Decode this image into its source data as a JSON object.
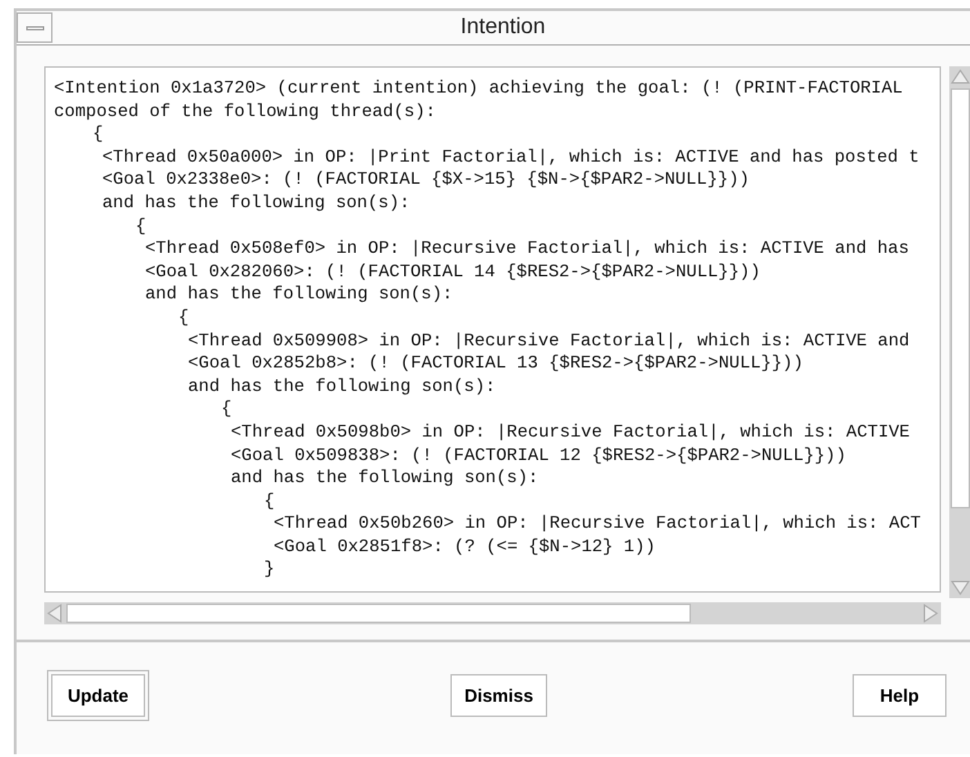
{
  "window": {
    "title": "Intention"
  },
  "listing": {
    "lines": [
      "<Intention 0x1a3720> (current intention) achieving the goal: (! (PRINT-FACTORIAL",
      "composed of the following thread(s):"
    ],
    "children": [
      {
        "open": "{",
        "lines": [
          "<Thread 0x50a000> in OP: |Print Factorial|, which is: ACTIVE and has posted t",
          "<Goal 0x2338e0>: (! (FACTORIAL {$X->15} {$N->{$PAR2->NULL}}))",
          "and has the following son(s):"
        ],
        "children": [
          {
            "open": "{",
            "lines": [
              "<Thread 0x508ef0> in OP: |Recursive Factorial|, which is: ACTIVE and has",
              "<Goal 0x282060>: (! (FACTORIAL 14 {$RES2->{$PAR2->NULL}}))",
              "and has the following son(s):"
            ],
            "children": [
              {
                "open": "{",
                "lines": [
                  "<Thread 0x509908> in OP: |Recursive Factorial|, which is: ACTIVE and",
                  "<Goal 0x2852b8>: (! (FACTORIAL 13 {$RES2->{$PAR2->NULL}}))",
                  "and has the following son(s):"
                ],
                "children": [
                  {
                    "open": "{",
                    "lines": [
                      "<Thread 0x5098b0> in OP: |Recursive Factorial|, which is: ACTIVE",
                      "<Goal 0x509838>: (! (FACTORIAL 12 {$RES2->{$PAR2->NULL}}))",
                      "and has the following son(s):"
                    ],
                    "children": [
                      {
                        "open": "{",
                        "lines": [
                          "<Thread 0x50b260> in OP: |Recursive Factorial|, which is: ACT",
                          "<Goal 0x2851f8>: (? (<= {$N->12} 1))"
                        ],
                        "close": "}"
                      }
                    ]
                  }
                ]
              }
            ]
          }
        ]
      }
    ]
  },
  "buttons": [
    {
      "label": "Update",
      "default": true
    },
    {
      "label": "Dismiss",
      "default": false
    },
    {
      "label": "Help",
      "default": false
    }
  ]
}
